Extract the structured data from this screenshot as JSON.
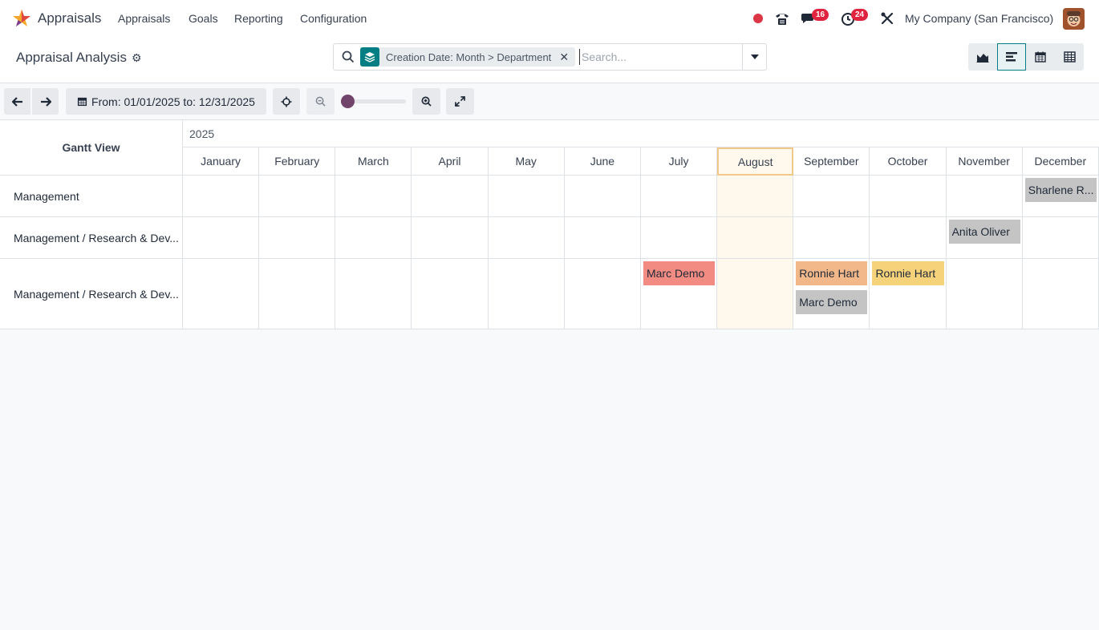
{
  "navbar": {
    "app_name": "Appraisals",
    "menus": [
      "Appraisals",
      "Goals",
      "Reporting",
      "Configuration"
    ],
    "messages_badge": "16",
    "activities_badge": "24",
    "company": "My Company (San Francisco)"
  },
  "control_panel": {
    "title": "Appraisal Analysis",
    "facet": "Creation Date: Month > Department",
    "search_placeholder": "Search..."
  },
  "toolbar": {
    "date_range": "From: 01/01/2025 to: 12/31/2025"
  },
  "gantt": {
    "title": "Gantt View",
    "year": "2025",
    "months": [
      "January",
      "February",
      "March",
      "April",
      "May",
      "June",
      "July",
      "August",
      "September",
      "October",
      "November",
      "December"
    ],
    "rows": [
      {
        "label": "Management",
        "pills": [
          {
            "name": "Sharlene R...",
            "month": 11,
            "lane": 0,
            "color": "#c4c4c4"
          }
        ]
      },
      {
        "label": "Management / Research & Dev...",
        "pills": [
          {
            "name": "Anita Oliver",
            "month": 10,
            "lane": 0,
            "color": "#c4c4c4"
          }
        ]
      },
      {
        "label": "Management / Research & Dev...",
        "pills": [
          {
            "name": "Marc Demo",
            "month": 6,
            "lane": 0,
            "color": "#f28b82"
          },
          {
            "name": "Ronnie Hart",
            "month": 8,
            "lane": 0,
            "color": "#f3b889"
          },
          {
            "name": "Ronnie Hart",
            "month": 9,
            "lane": 0,
            "color": "#f6d37b"
          },
          {
            "name": "Marc Demo",
            "month": 8,
            "lane": 1,
            "color": "#c4c4c4"
          }
        ]
      }
    ]
  }
}
